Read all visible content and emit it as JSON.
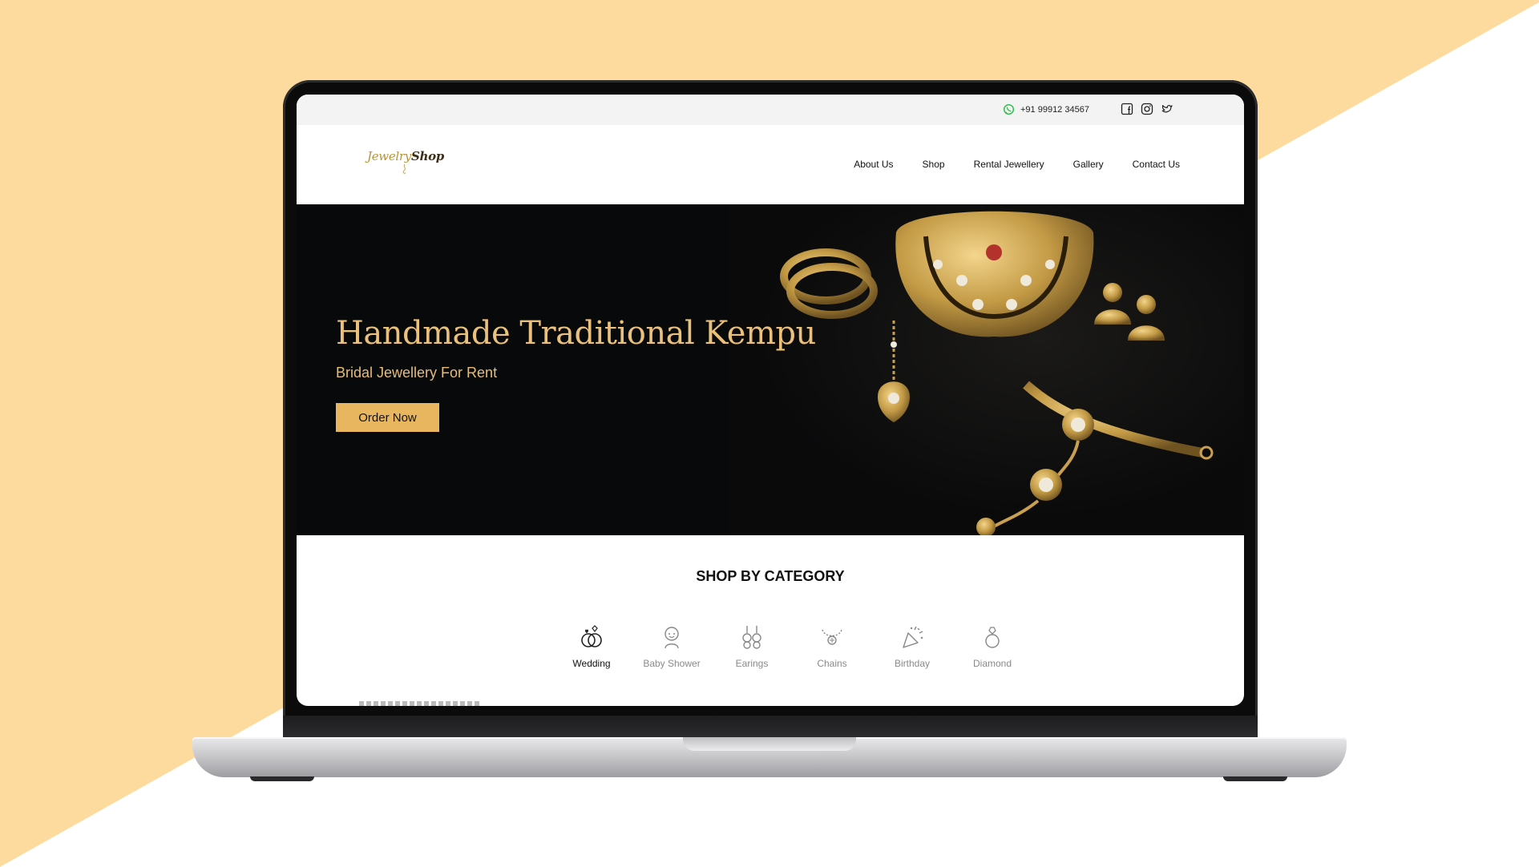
{
  "topbar": {
    "phone": "+91 99912 34567",
    "whatsapp_icon": "whatsapp-icon",
    "socials": [
      "facebook-icon",
      "instagram-icon",
      "twitter-icon"
    ]
  },
  "header": {
    "logo_part1": "Jewelry",
    "logo_part2": "Shop",
    "nav": [
      "About Us",
      "Shop",
      "Rental Jewellery",
      "Gallery",
      "Contact Us"
    ]
  },
  "hero": {
    "title": "Handmade Traditional Kempu",
    "subtitle": "Bridal Jewellery For Rent",
    "cta": "Order Now"
  },
  "category": {
    "title": "SHOP BY CATEGORY",
    "items": [
      {
        "label": "Wedding",
        "icon": "wedding-rings-icon",
        "active": true
      },
      {
        "label": "Baby Shower",
        "icon": "baby-icon",
        "active": false
      },
      {
        "label": "Earings",
        "icon": "earrings-icon",
        "active": false
      },
      {
        "label": "Chains",
        "icon": "necklace-icon",
        "active": false
      },
      {
        "label": "Birthday",
        "icon": "party-popper-icon",
        "active": false
      },
      {
        "label": "Diamond",
        "icon": "diamond-ring-icon",
        "active": false
      }
    ]
  },
  "colors": {
    "background_peach": "#fddb9f",
    "gold_accent": "#e7b65e",
    "hero_text": "#eac07a",
    "hero_bg": "#08090b"
  }
}
